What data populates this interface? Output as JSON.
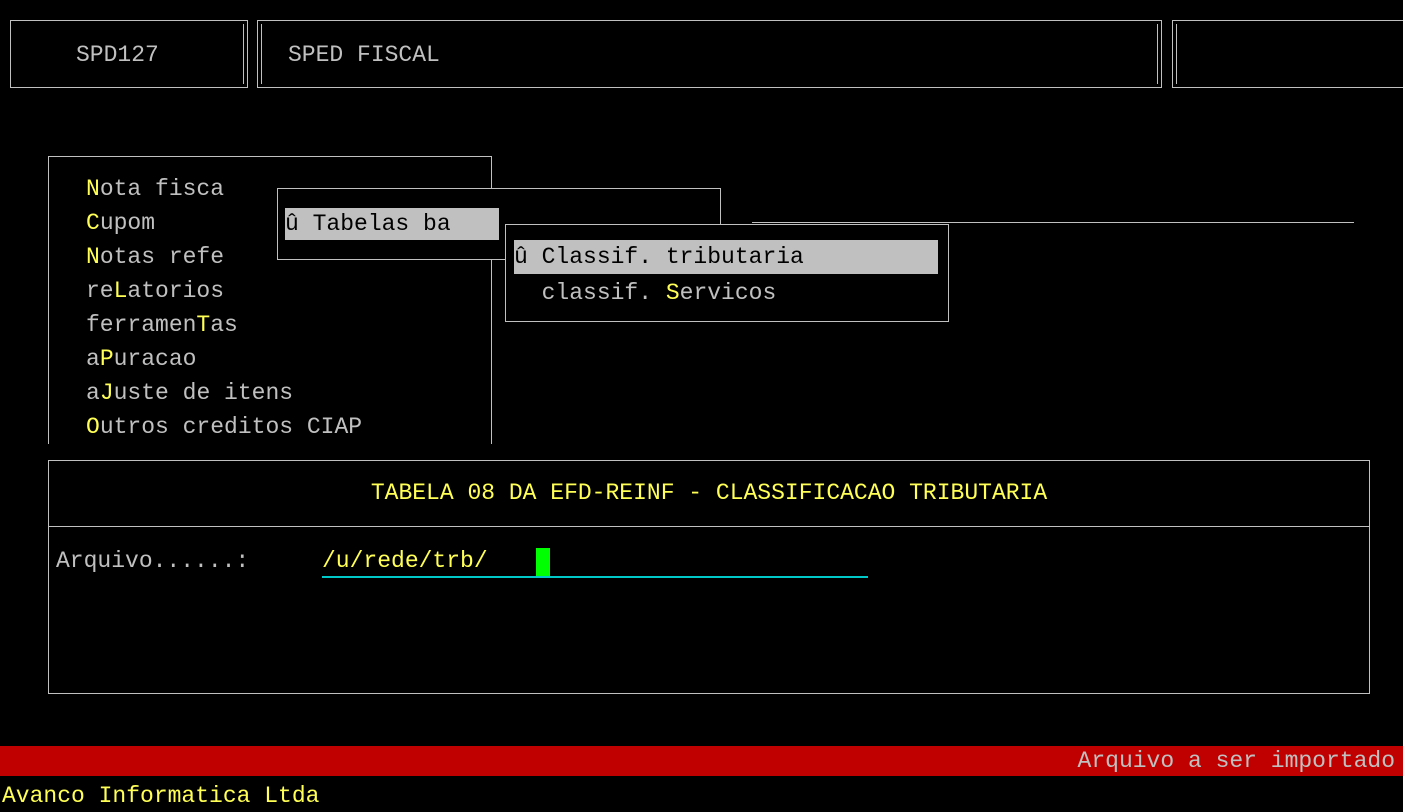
{
  "header": {
    "program_code": "SPD127",
    "system_title": "SPED FISCAL",
    "right_box": ""
  },
  "main_menu": {
    "items": [
      {
        "key": "N",
        "rest": "ota fisca"
      },
      {
        "key": "C",
        "rest": "upom"
      },
      {
        "key": "N",
        "rest": "otas refe"
      },
      {
        "pre": "re",
        "key": "L",
        "rest": "atorios"
      },
      {
        "pre": "ferramen",
        "key": "T",
        "rest": "as"
      },
      {
        "pre": "a",
        "key": "P",
        "rest": "uracao"
      },
      {
        "pre": "a",
        "key": "J",
        "rest": "uste de itens"
      },
      {
        "key": "O",
        "rest": "utros creditos CIAP"
      }
    ]
  },
  "submenu": {
    "selected_label": "û Tabelas ba"
  },
  "submenu2": {
    "items": [
      {
        "label": "û Classif. tributaria"
      },
      {
        "pre": "  classif. ",
        "key": "S",
        "rest": "ervicos"
      }
    ]
  },
  "dialog": {
    "title": "TABELA 08 DA EFD-REINF - CLASSIFICACAO TRIBUTARIA",
    "field_label": "Arquivo......:",
    "field_value": "/u/rede/trb/"
  },
  "status_bar": {
    "message": "Arquivo a ser importado"
  },
  "footer": {
    "company": "Avanco Informatica Ltda"
  },
  "colors": {
    "highlight": "#ffff55",
    "status_bar_bg": "#c00000",
    "cursor": "#00ff00",
    "field_underline": "#00c8c8"
  }
}
